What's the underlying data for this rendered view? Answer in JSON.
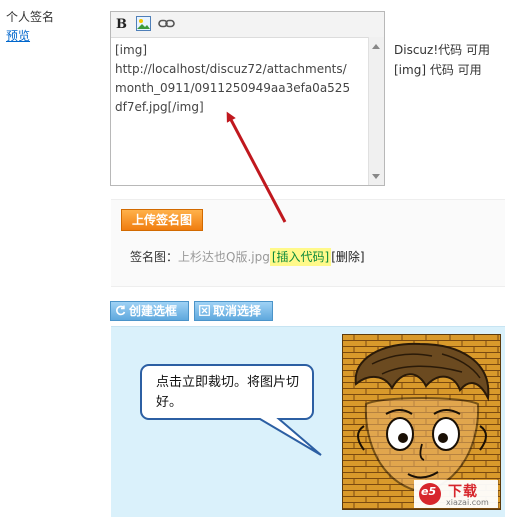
{
  "form": {
    "signature_label": "个人签名",
    "preview_link": "预览"
  },
  "editor": {
    "content": "[img]\nhttp://localhost/discuz72/attachments/\nmonth_0911/0911250949aa3efa0a525\ndf7ef.jpg[/img]"
  },
  "notes": {
    "discuz_code": "Discuz!代码 可用",
    "img_code": "[img] 代码 可用"
  },
  "upload": {
    "button_label": "上传签名图",
    "sig_prefix": "签名图：",
    "file_name": "上杉达也Q版.jpg",
    "insert_code": "[插入代码]",
    "delete": "[删除]"
  },
  "actions": {
    "create_label": "创建选框",
    "cancel_label": "取消选择"
  },
  "crop": {
    "callout_text": "点击立即裁切。将图片切好。"
  },
  "watermark": {
    "brand_mark": "e5",
    "brand_text": "下载",
    "domain": "xiazai.com"
  },
  "colors": {
    "annotation_arrow": "#c0181e",
    "upload_button": "#f07d10",
    "action_button": "#5fa8dd",
    "crop_background": "#daf1fb",
    "insert_code_highlight": "#fff98a"
  }
}
